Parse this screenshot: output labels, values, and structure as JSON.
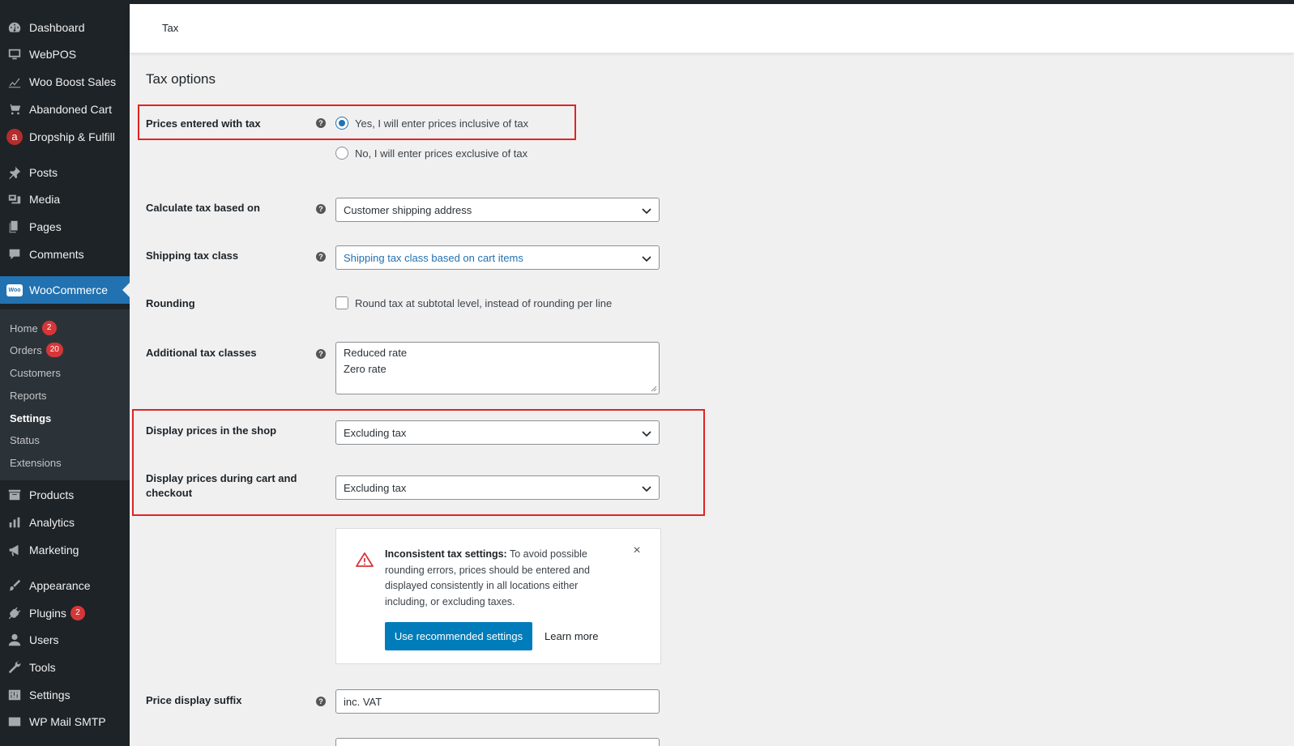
{
  "sidebar": {
    "top_items": [
      {
        "label": "Dashboard",
        "icon": "dashboard-icon"
      },
      {
        "label": "WebPOS",
        "icon": "monitor-icon"
      },
      {
        "label": "Woo Boost Sales",
        "icon": "chart-line-icon"
      },
      {
        "label": "Abandoned Cart",
        "icon": "cart-icon"
      },
      {
        "label": "Dropship & Fulfill",
        "icon": "dropship-icon",
        "icon_letter": "a"
      },
      {
        "label": "Posts",
        "icon": "pin-icon"
      },
      {
        "label": "Media",
        "icon": "media-icon"
      },
      {
        "label": "Pages",
        "icon": "pages-icon"
      },
      {
        "label": "Comments",
        "icon": "comment-icon"
      }
    ],
    "woocommerce": {
      "label": "WooCommerce",
      "icon": "woo-icon",
      "icon_text": "Woo"
    },
    "submenu": [
      {
        "label": "Home",
        "count": "2"
      },
      {
        "label": "Orders",
        "count": "20"
      },
      {
        "label": "Customers"
      },
      {
        "label": "Reports"
      },
      {
        "label": "Settings",
        "current": true
      },
      {
        "label": "Status"
      },
      {
        "label": "Extensions"
      }
    ],
    "bottom_items": [
      {
        "label": "Products",
        "icon": "archive-icon"
      },
      {
        "label": "Analytics",
        "icon": "bar-chart-icon"
      },
      {
        "label": "Marketing",
        "icon": "megaphone-icon"
      },
      {
        "label": "Appearance",
        "icon": "brush-icon"
      },
      {
        "label": "Plugins",
        "icon": "plugin-icon",
        "count": "2"
      },
      {
        "label": "Users",
        "icon": "user-icon"
      },
      {
        "label": "Tools",
        "icon": "wrench-icon"
      },
      {
        "label": "Settings",
        "icon": "settings-icon"
      },
      {
        "label": "WP Mail SMTP",
        "icon": "mail-icon"
      }
    ]
  },
  "header": {
    "title": "Tax"
  },
  "tax_options": {
    "title": "Tax options",
    "prices_entered": {
      "label": "Prices entered with tax",
      "option_yes": "Yes, I will enter prices inclusive of tax",
      "option_no": "No, I will enter prices exclusive of tax",
      "selected": "yes"
    },
    "calculate_based_on": {
      "label": "Calculate tax based on",
      "value": "Customer shipping address"
    },
    "shipping_tax_class": {
      "label": "Shipping tax class",
      "value": "Shipping tax class based on cart items"
    },
    "rounding": {
      "label": "Rounding",
      "checkbox_label": "Round tax at subtotal level, instead of rounding per line",
      "checked": false
    },
    "additional_classes": {
      "label": "Additional tax classes",
      "line1": "Reduced rate",
      "line2": "Zero rate"
    },
    "display_shop": {
      "label": "Display prices in the shop",
      "value": "Excluding tax"
    },
    "display_cart": {
      "label_line1": "Display prices during cart and",
      "label_line2": "checkout",
      "value": "Excluding tax"
    },
    "price_suffix": {
      "label": "Price display suffix",
      "value": "inc. VAT"
    }
  },
  "notice": {
    "title": "Inconsistent tax settings:",
    "body": " To avoid possible rounding errors, prices should be entered and displayed consistently in all locations either including, or excluding taxes.",
    "button": "Use recommended settings",
    "link": "Learn more",
    "close": "×"
  },
  "colors": {
    "accent": "#2271b1",
    "highlight_box": "#e02424",
    "sidebar_bg": "#1d2327",
    "button": "#007cba"
  }
}
